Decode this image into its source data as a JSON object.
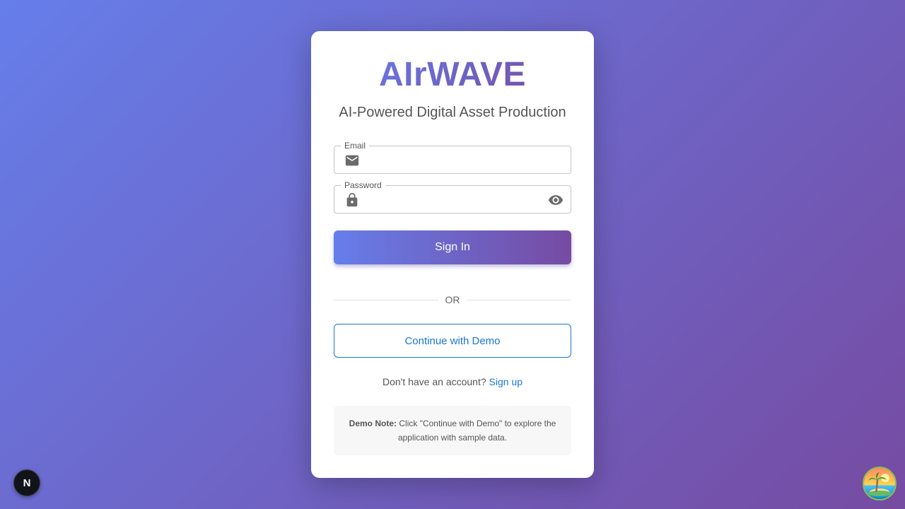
{
  "brand": {
    "title": "AIrWAVE",
    "tagline": "AI-Powered Digital Asset Production"
  },
  "form": {
    "email_label": "Email",
    "email_value": "",
    "password_label": "Password",
    "password_value": "",
    "submit_label": "Sign In"
  },
  "divider": {
    "text": "OR"
  },
  "demo": {
    "button_label": "Continue with Demo"
  },
  "signup": {
    "prompt": "Don't have an account?",
    "link_label": "Sign up"
  },
  "note": {
    "label": "Demo Note:",
    "text": "Click \"Continue with Demo\" to explore the application with sample data."
  },
  "corner": {
    "badge_letter": "N"
  },
  "icons": {
    "email": "mail-icon",
    "password": "lock-icon",
    "visibility": "eye-icon"
  },
  "colors": {
    "gradient_start": "#667eea",
    "gradient_end": "#764ba2",
    "link": "#1976d2"
  }
}
